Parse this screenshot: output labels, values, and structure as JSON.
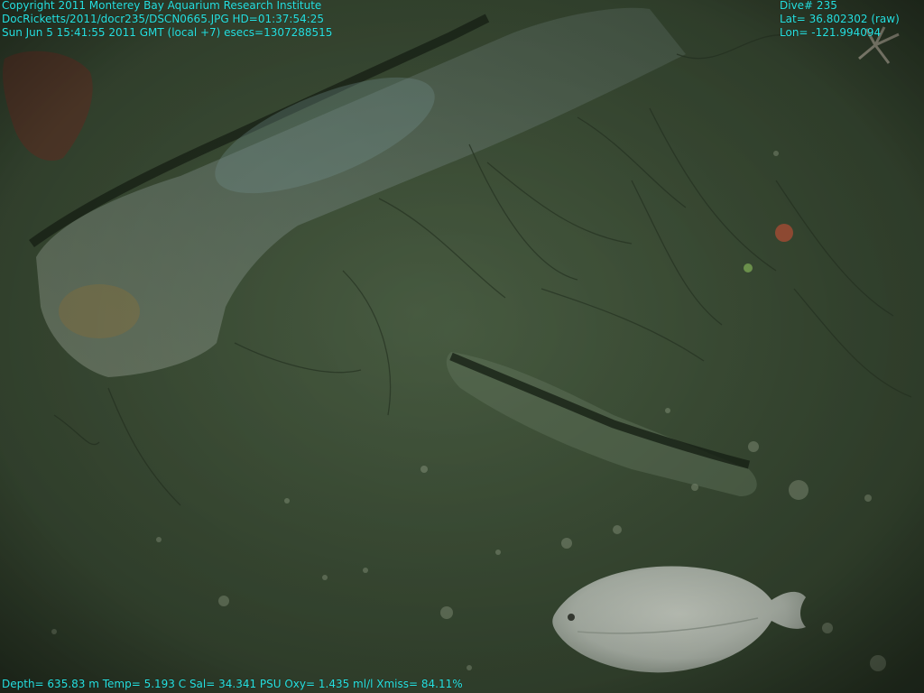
{
  "overlay": {
    "top_left": {
      "copyright": "Copyright 2011 Monterey Bay Aquarium Research Institute",
      "file_line": "DocRicketts/2011/docr235/DSCN0665.JPG   HD=01:37:54:25",
      "date_line": "Sun Jun  5 15:41:55 2011 GMT (local +7)  esecs=1307288515"
    },
    "top_right": {
      "dive": "Dive# 235",
      "lat": "Lat= 36.802302 (raw)",
      "lon": "Lon= -121.994094"
    },
    "bottom": {
      "sensors": "Depth= 635.83 m  Temp= 5.193 C  Sal= 34.341 PSU  Oxy= 1.435 ml/l  Xmiss= 84.11%"
    }
  },
  "colors": {
    "overlay_text": "#26e0e0",
    "water": "#3c4f37",
    "sediment": "#46583f",
    "flatfish": "#bfc7bd"
  }
}
